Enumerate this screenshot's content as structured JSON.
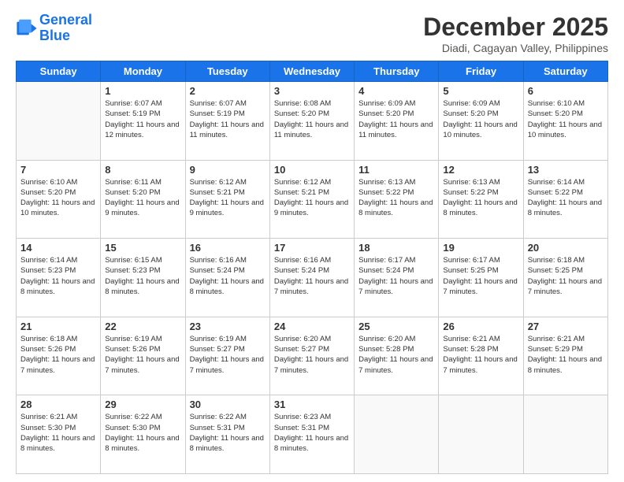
{
  "logo": {
    "line1": "General",
    "line2": "Blue"
  },
  "title": "December 2025",
  "subtitle": "Diadi, Cagayan Valley, Philippines",
  "days_header": [
    "Sunday",
    "Monday",
    "Tuesday",
    "Wednesday",
    "Thursday",
    "Friday",
    "Saturday"
  ],
  "weeks": [
    [
      {
        "num": "",
        "info": ""
      },
      {
        "num": "1",
        "info": "Sunrise: 6:07 AM\nSunset: 5:19 PM\nDaylight: 11 hours\nand 12 minutes."
      },
      {
        "num": "2",
        "info": "Sunrise: 6:07 AM\nSunset: 5:19 PM\nDaylight: 11 hours\nand 11 minutes."
      },
      {
        "num": "3",
        "info": "Sunrise: 6:08 AM\nSunset: 5:20 PM\nDaylight: 11 hours\nand 11 minutes."
      },
      {
        "num": "4",
        "info": "Sunrise: 6:09 AM\nSunset: 5:20 PM\nDaylight: 11 hours\nand 11 minutes."
      },
      {
        "num": "5",
        "info": "Sunrise: 6:09 AM\nSunset: 5:20 PM\nDaylight: 11 hours\nand 10 minutes."
      },
      {
        "num": "6",
        "info": "Sunrise: 6:10 AM\nSunset: 5:20 PM\nDaylight: 11 hours\nand 10 minutes."
      }
    ],
    [
      {
        "num": "7",
        "info": "Sunrise: 6:10 AM\nSunset: 5:20 PM\nDaylight: 11 hours\nand 10 minutes."
      },
      {
        "num": "8",
        "info": "Sunrise: 6:11 AM\nSunset: 5:20 PM\nDaylight: 11 hours\nand 9 minutes."
      },
      {
        "num": "9",
        "info": "Sunrise: 6:12 AM\nSunset: 5:21 PM\nDaylight: 11 hours\nand 9 minutes."
      },
      {
        "num": "10",
        "info": "Sunrise: 6:12 AM\nSunset: 5:21 PM\nDaylight: 11 hours\nand 9 minutes."
      },
      {
        "num": "11",
        "info": "Sunrise: 6:13 AM\nSunset: 5:22 PM\nDaylight: 11 hours\nand 8 minutes."
      },
      {
        "num": "12",
        "info": "Sunrise: 6:13 AM\nSunset: 5:22 PM\nDaylight: 11 hours\nand 8 minutes."
      },
      {
        "num": "13",
        "info": "Sunrise: 6:14 AM\nSunset: 5:22 PM\nDaylight: 11 hours\nand 8 minutes."
      }
    ],
    [
      {
        "num": "14",
        "info": "Sunrise: 6:14 AM\nSunset: 5:23 PM\nDaylight: 11 hours\nand 8 minutes."
      },
      {
        "num": "15",
        "info": "Sunrise: 6:15 AM\nSunset: 5:23 PM\nDaylight: 11 hours\nand 8 minutes."
      },
      {
        "num": "16",
        "info": "Sunrise: 6:16 AM\nSunset: 5:24 PM\nDaylight: 11 hours\nand 8 minutes."
      },
      {
        "num": "17",
        "info": "Sunrise: 6:16 AM\nSunset: 5:24 PM\nDaylight: 11 hours\nand 7 minutes."
      },
      {
        "num": "18",
        "info": "Sunrise: 6:17 AM\nSunset: 5:24 PM\nDaylight: 11 hours\nand 7 minutes."
      },
      {
        "num": "19",
        "info": "Sunrise: 6:17 AM\nSunset: 5:25 PM\nDaylight: 11 hours\nand 7 minutes."
      },
      {
        "num": "20",
        "info": "Sunrise: 6:18 AM\nSunset: 5:25 PM\nDaylight: 11 hours\nand 7 minutes."
      }
    ],
    [
      {
        "num": "21",
        "info": "Sunrise: 6:18 AM\nSunset: 5:26 PM\nDaylight: 11 hours\nand 7 minutes."
      },
      {
        "num": "22",
        "info": "Sunrise: 6:19 AM\nSunset: 5:26 PM\nDaylight: 11 hours\nand 7 minutes."
      },
      {
        "num": "23",
        "info": "Sunrise: 6:19 AM\nSunset: 5:27 PM\nDaylight: 11 hours\nand 7 minutes."
      },
      {
        "num": "24",
        "info": "Sunrise: 6:20 AM\nSunset: 5:27 PM\nDaylight: 11 hours\nand 7 minutes."
      },
      {
        "num": "25",
        "info": "Sunrise: 6:20 AM\nSunset: 5:28 PM\nDaylight: 11 hours\nand 7 minutes."
      },
      {
        "num": "26",
        "info": "Sunrise: 6:21 AM\nSunset: 5:28 PM\nDaylight: 11 hours\nand 7 minutes."
      },
      {
        "num": "27",
        "info": "Sunrise: 6:21 AM\nSunset: 5:29 PM\nDaylight: 11 hours\nand 8 minutes."
      }
    ],
    [
      {
        "num": "28",
        "info": "Sunrise: 6:21 AM\nSunset: 5:30 PM\nDaylight: 11 hours\nand 8 minutes."
      },
      {
        "num": "29",
        "info": "Sunrise: 6:22 AM\nSunset: 5:30 PM\nDaylight: 11 hours\nand 8 minutes."
      },
      {
        "num": "30",
        "info": "Sunrise: 6:22 AM\nSunset: 5:31 PM\nDaylight: 11 hours\nand 8 minutes."
      },
      {
        "num": "31",
        "info": "Sunrise: 6:23 AM\nSunset: 5:31 PM\nDaylight: 11 hours\nand 8 minutes."
      },
      {
        "num": "",
        "info": ""
      },
      {
        "num": "",
        "info": ""
      },
      {
        "num": "",
        "info": ""
      }
    ]
  ]
}
